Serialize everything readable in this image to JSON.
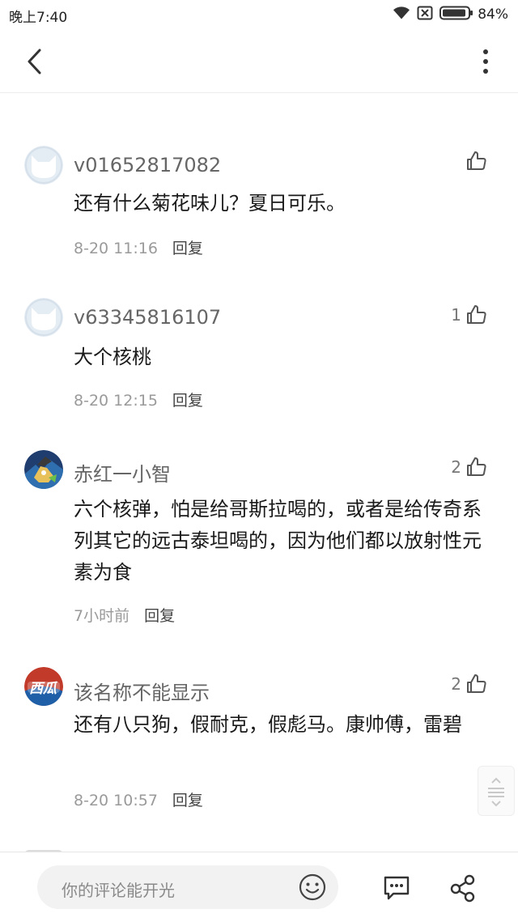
{
  "status_bar": {
    "time": "晚上7:40",
    "battery": "84%"
  },
  "icons": {
    "back": "chevron-left-icon",
    "more": "more-vertical-icon",
    "like": "thumbs-up-icon",
    "emoji": "smiley-icon",
    "message": "chat-bubble-icon",
    "share": "share-icon"
  },
  "comments": [
    {
      "username": "v01652817082",
      "likes": "",
      "text": "还有什么菊花味儿？夏日可乐。",
      "time": "8-20 11:16",
      "reply": "回复"
    },
    {
      "username": "v63345816107",
      "likes": "1",
      "text": "大个核桃",
      "time": "8-20 12:15",
      "reply": "回复"
    },
    {
      "username": "赤红一小智",
      "likes": "2",
      "text": "六个核弹，怕是给哥斯拉喝的，或者是给传奇系列其它的远古泰坦喝的，因为他们都以放射性元素为食",
      "time": "7小时前",
      "reply": "回复"
    },
    {
      "username": "该名称不能显示",
      "likes": "2",
      "text": "还有八只狗，假耐克，假彪马。康帅傅，雷碧",
      "time": "8-20 10:57",
      "reply": "回复"
    }
  ],
  "avatar_badge": "西瓜",
  "bottom_bar": {
    "placeholder": "你的评论能开光"
  }
}
